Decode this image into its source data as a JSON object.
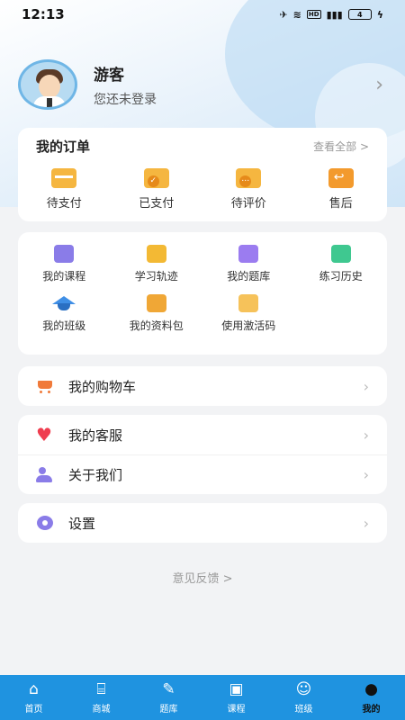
{
  "status_bar": {
    "time": "12:13",
    "battery": "4",
    "network": "HD"
  },
  "profile": {
    "name": "游客",
    "subtitle": "您还未登录"
  },
  "orders": {
    "title": "我的订单",
    "view_all": "查看全部 >",
    "items": [
      {
        "label": "待支付",
        "icon": "card-icon"
      },
      {
        "label": "已支付",
        "icon": "paid-icon"
      },
      {
        "label": "待评价",
        "icon": "review-icon"
      },
      {
        "label": "售后",
        "icon": "after-sale-icon"
      }
    ]
  },
  "tools": [
    {
      "label": "我的课程",
      "icon": "course-icon"
    },
    {
      "label": "学习轨迹",
      "icon": "track-icon"
    },
    {
      "label": "我的题库",
      "icon": "question-bank-icon"
    },
    {
      "label": "练习历史",
      "icon": "history-icon"
    },
    {
      "label": "我的班级",
      "icon": "class-icon"
    },
    {
      "label": "我的资料包",
      "icon": "folder-icon"
    },
    {
      "label": "使用激活码",
      "icon": "activation-code-icon"
    }
  ],
  "menu": {
    "cart": "我的购物车",
    "service": "我的客服",
    "about": "关于我们",
    "settings": "设置"
  },
  "feedback": "意见反馈 >",
  "tabbar": [
    {
      "label": "首页",
      "icon": "home-icon"
    },
    {
      "label": "商城",
      "icon": "store-icon"
    },
    {
      "label": "题库",
      "icon": "pencil-icon"
    },
    {
      "label": "课程",
      "icon": "video-icon"
    },
    {
      "label": "班级",
      "icon": "group-icon"
    },
    {
      "label": "我的",
      "icon": "user-icon"
    }
  ],
  "colors": {
    "accent": "#1f93e0",
    "background": "#f2f3f5"
  }
}
